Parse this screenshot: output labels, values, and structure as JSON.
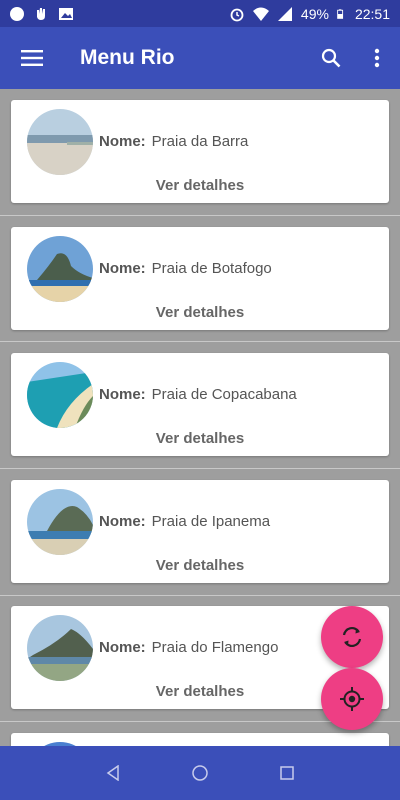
{
  "status_bar": {
    "battery": "49%",
    "time": "22:51"
  },
  "app_bar": {
    "title": "Menu Rio",
    "menu_icon": "hamburger-menu-icon",
    "search_icon": "search-icon",
    "overflow_icon": "more-vert-icon"
  },
  "colors": {
    "status_bar": "#2f3c9e",
    "app_bar": "#3b4fb9",
    "fab": "#ee3e84",
    "background": "#9e9e9e"
  },
  "beaches": {
    "name_label": "Nome:",
    "details_label": "Ver detalhes",
    "items": [
      {
        "name": "Praia da Barra"
      },
      {
        "name": "Praia de Botafogo"
      },
      {
        "name": "Praia de Copacabana"
      },
      {
        "name": "Praia de Ipanema"
      },
      {
        "name": "Praia do Flamengo"
      }
    ]
  },
  "fabs": {
    "sync_icon": "sync-icon",
    "location_icon": "my-location-icon"
  },
  "nav_bar": {
    "back_icon": "back-icon",
    "home_icon": "home-icon",
    "recents_icon": "recents-icon"
  }
}
